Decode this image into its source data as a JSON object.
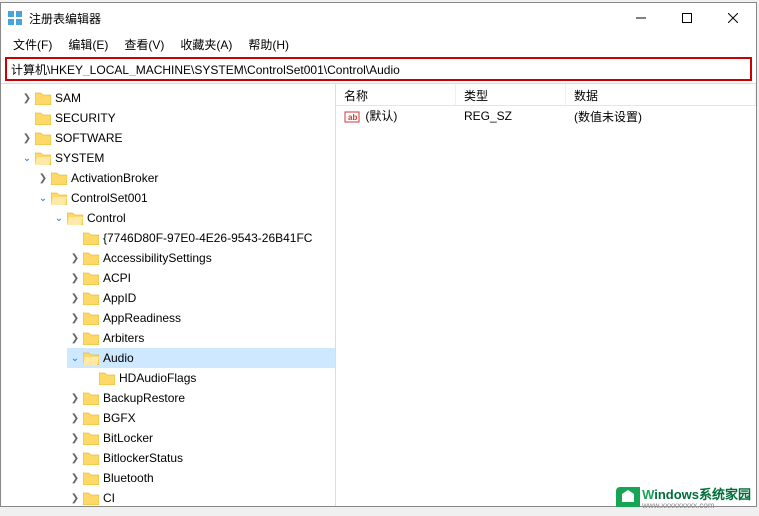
{
  "window": {
    "title": "注册表编辑器"
  },
  "menubar": {
    "file": "文件(F)",
    "edit": "编辑(E)",
    "view": "查看(V)",
    "favorites": "收藏夹(A)",
    "help": "帮助(H)"
  },
  "addressbar": {
    "path": "计算机\\HKEY_LOCAL_MACHINE\\SYSTEM\\ControlSet001\\Control\\Audio"
  },
  "tree": {
    "sam": "SAM",
    "security": "SECURITY",
    "software": "SOFTWARE",
    "system": "SYSTEM",
    "activationbroker": "ActivationBroker",
    "controlset001": "ControlSet001",
    "control": "Control",
    "guid": "{7746D80F-97E0-4E26-9543-26B41FC",
    "accessibility": "AccessibilitySettings",
    "acpi": "ACPI",
    "appid": "AppID",
    "appreadiness": "AppReadiness",
    "arbiters": "Arbiters",
    "audio": "Audio",
    "hdaudioflags": "HDAudioFlags",
    "backuprestore": "BackupRestore",
    "bgfx": "BGFX",
    "bitlocker": "BitLocker",
    "bitlockerstatus": "BitlockerStatus",
    "bluetooth": "Bluetooth",
    "ci": "CI"
  },
  "list": {
    "header": {
      "name": "名称",
      "type": "类型",
      "data": "数据"
    },
    "row1": {
      "name": "(默认)",
      "type": "REG_SZ",
      "data": "(数值未设置)"
    }
  },
  "watermark": {
    "main": "indows系统家园",
    "letter": "W",
    "sub": "www.xxxxxxxxx.com"
  }
}
